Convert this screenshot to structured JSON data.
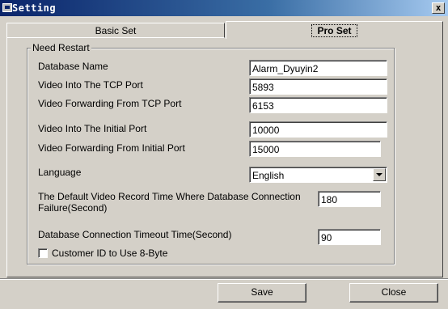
{
  "window": {
    "title": "Setting",
    "close_label": "x"
  },
  "tabs": [
    {
      "label": "Basic Set",
      "active": false
    },
    {
      "label": "Pro Set",
      "active": true
    }
  ],
  "group": {
    "title": "Need Restart"
  },
  "fields": [
    {
      "label": "Database Name",
      "value": "Alarm_Dyuyin2"
    },
    {
      "label": "Video Into The TCP Port",
      "value": "5893"
    },
    {
      "label": "Video Forwarding From TCP Port",
      "value": "6153"
    },
    {
      "label": "Video Into The Initial Port",
      "value": "10000"
    },
    {
      "label": "Video Forwarding From Initial Port",
      "value": "15000"
    },
    {
      "label": "Language",
      "value": "English"
    },
    {
      "label_line1": "The Default Video Record Time Where Database Connection",
      "label_line2": "Failure(Second)",
      "value": "180"
    },
    {
      "label": "Database Connection Timeout Time(Second)",
      "value": "90"
    }
  ],
  "checkbox": {
    "label": "Customer ID to Use 8-Byte",
    "checked": false
  },
  "buttons": {
    "save": "Save",
    "close": "Close"
  }
}
